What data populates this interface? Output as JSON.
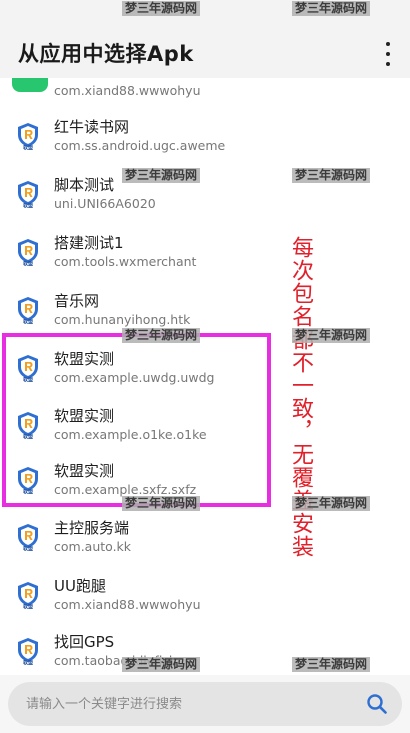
{
  "header": {
    "title": "从应用中选择Apk"
  },
  "colors": {
    "accent": "#2f6fd1",
    "highlight": "#e72ee0",
    "note": "#e0202a",
    "partial_icon": "#28c76f"
  },
  "icons": {
    "app_icon": "ruanmeng-shield-icon",
    "menu": "more-vertical-icon",
    "search": "search-icon"
  },
  "apps": [
    {
      "name": "",
      "package": "com.xiand88.wwwohyu"
    },
    {
      "name": "红牛读书网",
      "package": "com.ss.android.ugc.aweme"
    },
    {
      "name": "脚本测试",
      "package": "uni.UNI66A6020"
    },
    {
      "name": "搭建测试1",
      "package": "com.tools.wxmerchant"
    },
    {
      "name": "音乐网",
      "package": "com.hunanyihong.htk"
    },
    {
      "name": "软盟实测",
      "package": "com.example.uwdg.uwdg"
    },
    {
      "name": "软盟实测",
      "package": "com.example.o1ke.o1ke"
    },
    {
      "name": "软盟实测",
      "package": "com.example.sxfz.sxfz"
    },
    {
      "name": "主控服务端",
      "package": "com.auto.kk"
    },
    {
      "name": "UU跑腿",
      "package": "com.xiand88.wwwohyu"
    },
    {
      "name": "找回GPS",
      "package": "com.taobao.idlefish"
    }
  ],
  "icon_label": "软盟",
  "annotation": "每次包名都不一致，无覆盖安装",
  "watermark": "梦三年源码网",
  "search": {
    "placeholder": "请输入一个关键字进行搜索"
  }
}
